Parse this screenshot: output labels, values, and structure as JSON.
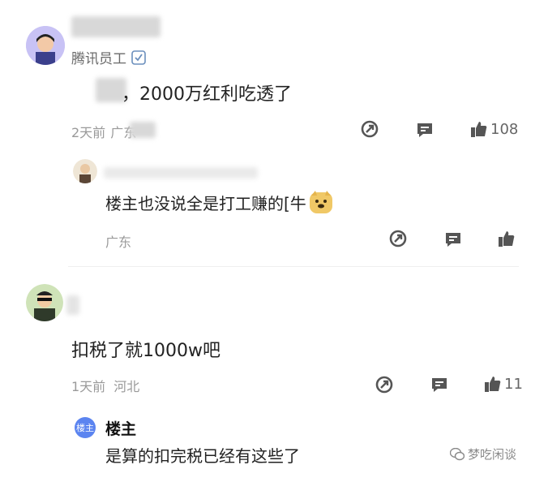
{
  "comment1": {
    "author_title": "腾讯员工",
    "text": "，2000万红利吃透了",
    "time": "2天前",
    "location": "广东",
    "like_count": "108"
  },
  "reply1": {
    "text": "楼主也没说全是打工赚的[牛",
    "location": "广东"
  },
  "comment2": {
    "text": "扣税了就1000w吧",
    "time": "1天前",
    "location": "河北",
    "like_count": "11"
  },
  "reply2": {
    "badge": "楼主",
    "author": "楼主",
    "text": "是算的扣完税已经有这些了"
  },
  "watermark": "梦吃闲谈",
  "colors": {
    "accent": "#5b84f0",
    "meta": "#9a9a9a"
  },
  "icons": [
    "share-icon",
    "comment-icon",
    "thumbs-up-icon",
    "verified-icon",
    "doge-emoji-icon",
    "wechat-icon"
  ]
}
